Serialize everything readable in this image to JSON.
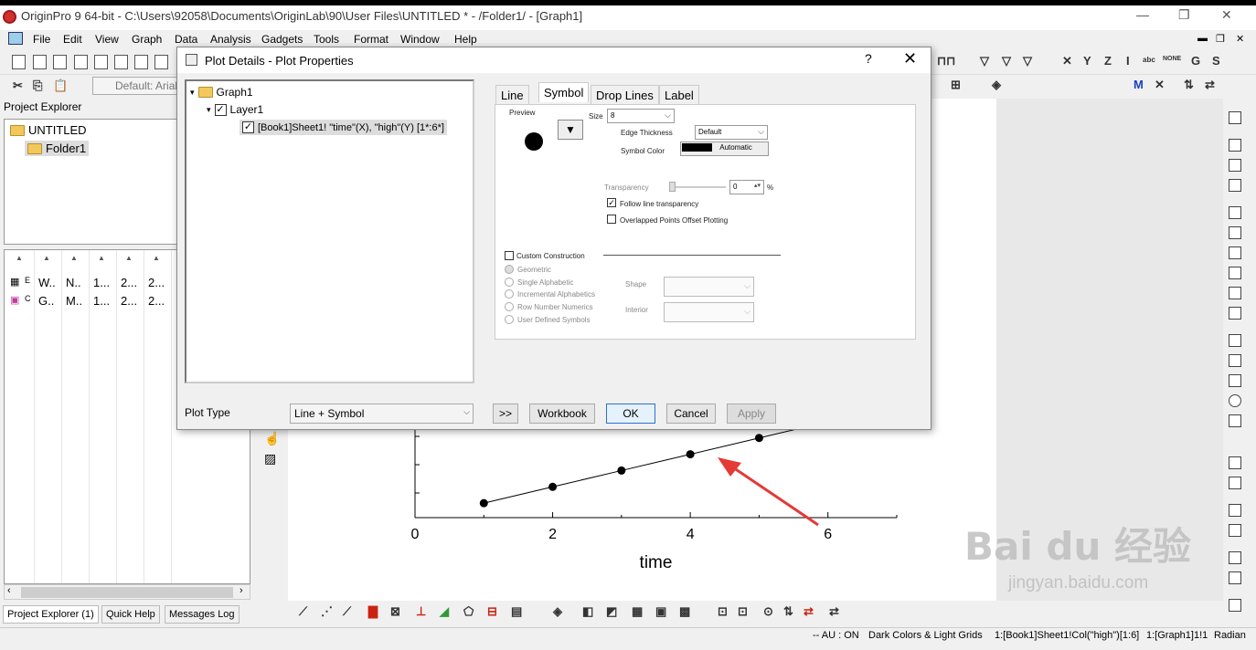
{
  "window": {
    "title": "OriginPro 9 64-bit - C:\\Users\\92058\\Documents\\OriginLab\\90\\User Files\\UNTITLED * - /Folder1/ - [Graph1]"
  },
  "menubar": [
    "File",
    "Edit",
    "View",
    "Graph",
    "Data",
    "Analysis",
    "Gadgets",
    "Tools",
    "Format",
    "Window",
    "Help"
  ],
  "toolbar": {
    "font_combo": "Default: Arial"
  },
  "project_explorer": {
    "title": "Project Explorer",
    "tree": {
      "root": "UNTITLED",
      "folder": "Folder1"
    },
    "list_rows": [
      [
        "W..",
        "N..",
        "1...",
        "2...",
        "2..."
      ],
      [
        "G..",
        "M..",
        "1...",
        "2...",
        "2..."
      ]
    ],
    "row_prefix": [
      "E",
      "C"
    ]
  },
  "bottom_tabs": [
    "Project Explorer (1)",
    "Quick Help",
    "Messages Log"
  ],
  "dialog": {
    "title": "Plot Details - Plot Properties",
    "help": "?",
    "close": "✕",
    "tree": {
      "graph": "Graph1",
      "layer": "Layer1",
      "plot": "[Book1]Sheet1! \"time\"(X), \"high\"(Y) [1*:6*]"
    },
    "tabs": [
      "Line",
      "Symbol",
      "Drop Lines",
      "Label"
    ],
    "active_tab": "Symbol",
    "symbol": {
      "preview_label": "Preview",
      "size_label": "Size",
      "size_value": "8",
      "edge_thickness_label": "Edge Thickness",
      "edge_thickness_value": "Default",
      "symbol_color_label": "Symbol Color",
      "symbol_color_value": "Automatic",
      "transparency_label": "Transparency",
      "transparency_value": "0",
      "transparency_unit": "%",
      "follow_line_label": "Follow line transparency",
      "follow_line_checked": true,
      "overlapped_label": "Overlapped Points Offset Plotting",
      "overlapped_checked": false,
      "custom_construction_label": "Custom Construction",
      "options": [
        "Geometric",
        "Single Alphabetic",
        "Incremental Alphabetics",
        "Row Number Numerics",
        "User Defined Symbols"
      ],
      "shape_label": "Shape",
      "interior_label": "Interior"
    },
    "plot_type_label": "Plot Type",
    "plot_type_value": "Line + Symbol",
    "buttons": {
      "expand": ">>",
      "workbook": "Workbook",
      "ok": "OK",
      "cancel": "Cancel",
      "apply": "Apply"
    }
  },
  "chart_data": {
    "type": "line",
    "x": [
      1,
      2,
      3,
      4,
      5,
      6
    ],
    "y": [
      1.0,
      1.45,
      1.9,
      2.35,
      2.8,
      3.25
    ],
    "xlabel": "time",
    "xlim": [
      0,
      7
    ],
    "xticks": [
      "0",
      "2",
      "4",
      "6"
    ],
    "marker": "circle",
    "color": "#000000",
    "annotation": "red arrow pointing at the data line"
  },
  "statusbar": {
    "au": "-- AU : ON",
    "theme": "Dark Colors & Light Grids",
    "col": "1:[Book1]Sheet1!Col(\"high\")[1:6]",
    "graph": "1:[Graph1]1!1",
    "unit": "Radian"
  },
  "watermark": {
    "logo": "Bai du 经验",
    "url": "jingyan.baidu.com"
  },
  "colors": {
    "accent": "#2b6fd6",
    "arrow": "#e53935",
    "folder": "#f2c85a"
  }
}
